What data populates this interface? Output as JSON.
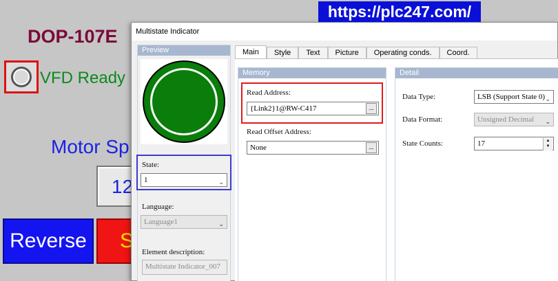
{
  "background": {
    "title": "DOP-107E",
    "indicator_label": "VFD Ready",
    "motor_label": "Motor Sp",
    "speed_value": "12",
    "reverse_button": "Reverse",
    "stop_button_partial": "S"
  },
  "watermark": "https://plc247.com/",
  "dialog": {
    "title": "Multistate Indicator",
    "preview": {
      "header": "Preview",
      "lamp_color": "#0a7d0a",
      "state_label": "State:",
      "state_value": "1",
      "language_label": "Language:",
      "language_value": "Language1",
      "element_desc_label": "Element description:",
      "element_desc_value": "Multistate Indicator_007"
    },
    "tabs": [
      "Main",
      "Style",
      "Text",
      "Picture",
      "Operating conds.",
      "Coord."
    ],
    "active_tab": "Main",
    "memory": {
      "header": "Memory",
      "read_address_label": "Read Address:",
      "read_address_value": "{Link2}1@RW-C417",
      "read_offset_label": "Read Offset Address:",
      "read_offset_value": "None",
      "browse_label": "..."
    },
    "detail": {
      "header": "Detail",
      "data_type_label": "Data Type:",
      "data_type_value": "LSB (Support State 0)",
      "data_format_label": "Data Format:",
      "data_format_value": "Unsigned Decimal",
      "state_counts_label": "State Counts:",
      "state_counts_value": "17"
    }
  }
}
